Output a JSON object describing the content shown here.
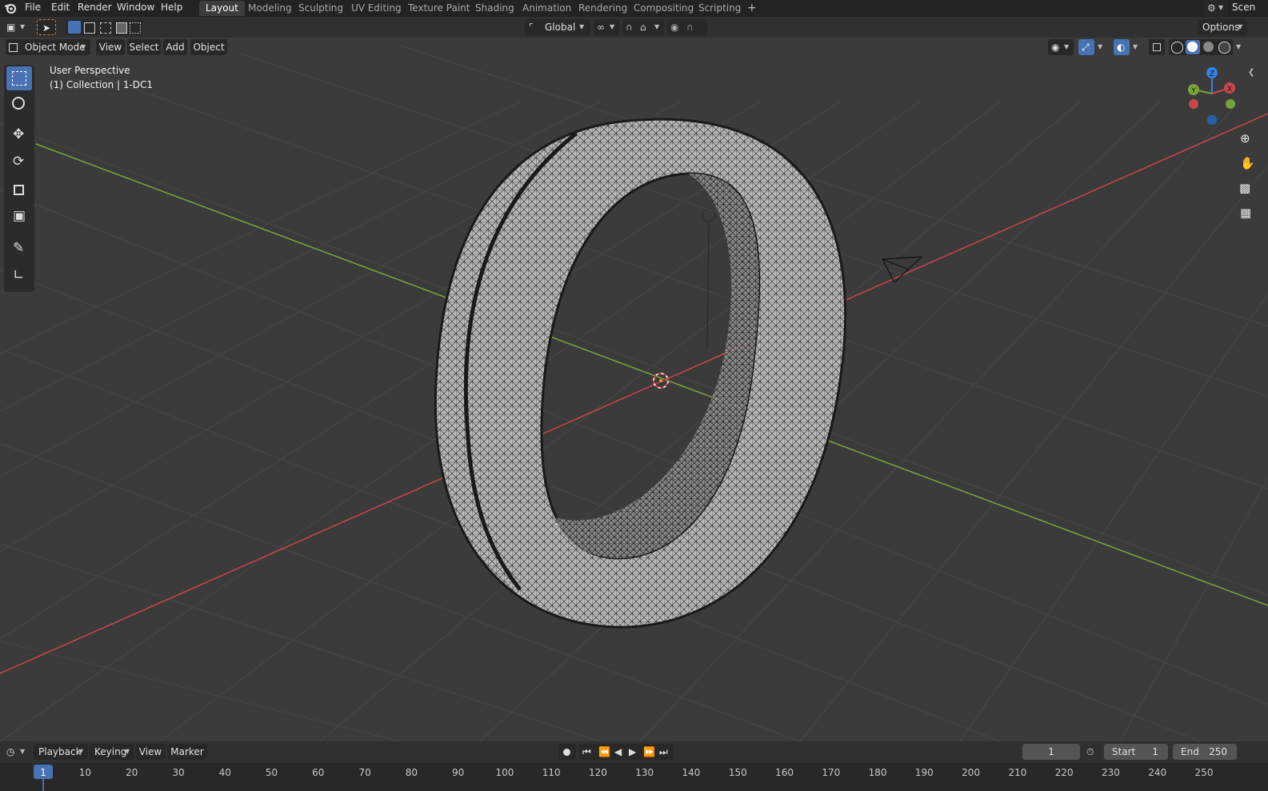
{
  "menu": [
    "File",
    "Edit",
    "Render",
    "Window",
    "Help"
  ],
  "workspaces": [
    "Layout",
    "Modeling",
    "Sculpting",
    "UV Editing",
    "Texture Paint",
    "Shading",
    "Animation",
    "Rendering",
    "Compositing",
    "Scripting"
  ],
  "active_workspace": "Layout",
  "add_workspace": "+",
  "scene_label": "Scen",
  "header": {
    "orientation": "Global",
    "options": "Options"
  },
  "viewport_header": {
    "mode": "Object Mode",
    "menus": [
      "View",
      "Select",
      "Add",
      "Object"
    ]
  },
  "overlay": {
    "line1": "User Perspective",
    "line2": "(1) Collection | 1-DC1"
  },
  "gizmo": {
    "x": "X",
    "y": "Y",
    "z": "Z"
  },
  "timeline": {
    "menus": [
      "Playback",
      "Keying",
      "View",
      "Marker"
    ],
    "current_frame": "1",
    "start_label": "Start",
    "start": "1",
    "end_label": "End",
    "end": "250",
    "ticks": [
      "1",
      "10",
      "20",
      "30",
      "40",
      "50",
      "60",
      "70",
      "80",
      "90",
      "100",
      "110",
      "120",
      "130",
      "140",
      "150",
      "160",
      "170",
      "180",
      "190",
      "200",
      "210",
      "220",
      "230",
      "240",
      "250"
    ]
  },
  "colors": {
    "x_axis": "#c9454d",
    "y_axis": "#7ca33a",
    "active": "#4772b3",
    "z_axis": "#2f83e3"
  }
}
